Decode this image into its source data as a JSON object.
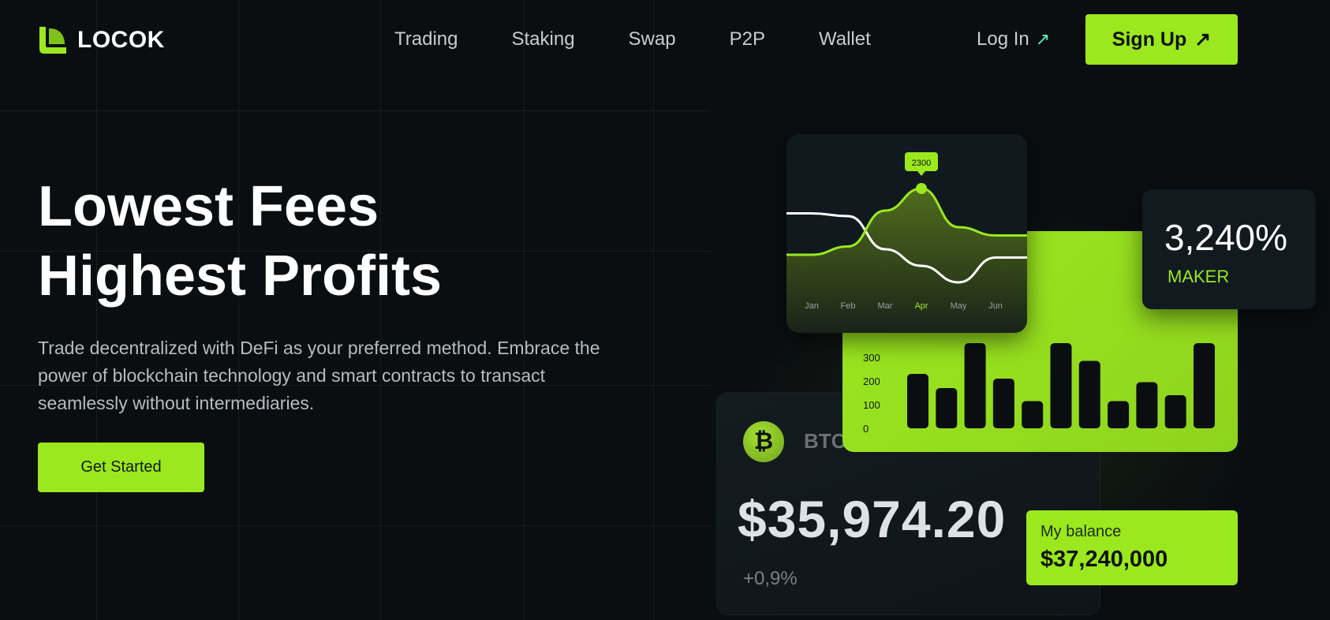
{
  "brand": {
    "name": "LOCOK",
    "accent": "#9be81f",
    "login_arrow_color": "#5ff0b4"
  },
  "nav": {
    "links": [
      "Trading",
      "Staking",
      "Swap",
      "P2P",
      "Wallet"
    ],
    "login_label": "Log In",
    "signup_label": "Sign Up"
  },
  "hero": {
    "title_line1": "Lowest Fees",
    "title_line2": "Highest Profits",
    "subtitle": "Trade decentralized with DeFi as your preferred method. Embrace the power of blockchain technology and smart contracts to transact seamlessly without intermediaries.",
    "cta_label": "Get Started"
  },
  "btc_card": {
    "symbol": "BTC",
    "icon": "bitcoin-icon",
    "price": "$35,974.20",
    "change": "+0,9%"
  },
  "line_chart": {
    "months": [
      "Jan",
      "Feb",
      "Mar",
      "Apr",
      "May",
      "Jun"
    ],
    "active_month": "Apr",
    "tooltip": "2300"
  },
  "bar_chart": {
    "y_ticks": [
      "300",
      "200",
      "100",
      "0"
    ]
  },
  "maker_card": {
    "value": "3,240%",
    "label": "MAKER"
  },
  "balance_card": {
    "label": "My balance",
    "value": "$37,240,000"
  },
  "chart_data": [
    {
      "type": "line",
      "x": [
        "Jan",
        "Feb",
        "Mar",
        "Apr",
        "May",
        "Jun"
      ],
      "series": [
        {
          "values": [
            1100,
            1250,
            1900,
            2300,
            1600,
            1450
          ],
          "color": "#9be81f"
        },
        {
          "values": [
            1850,
            1800,
            1200,
            900,
            600,
            1050
          ],
          "color": "#ffffff"
        }
      ],
      "highlight": {
        "x": "Apr",
        "value": 2300
      },
      "ylim": [
        0,
        3000
      ]
    },
    {
      "type": "bar",
      "values": [
        230,
        170,
        360,
        210,
        115,
        360,
        285,
        115,
        195,
        140,
        360
      ],
      "ylim": [
        0,
        380
      ],
      "yticks": [
        0,
        100,
        200,
        300
      ],
      "bar_color": "#0a0e10"
    }
  ]
}
